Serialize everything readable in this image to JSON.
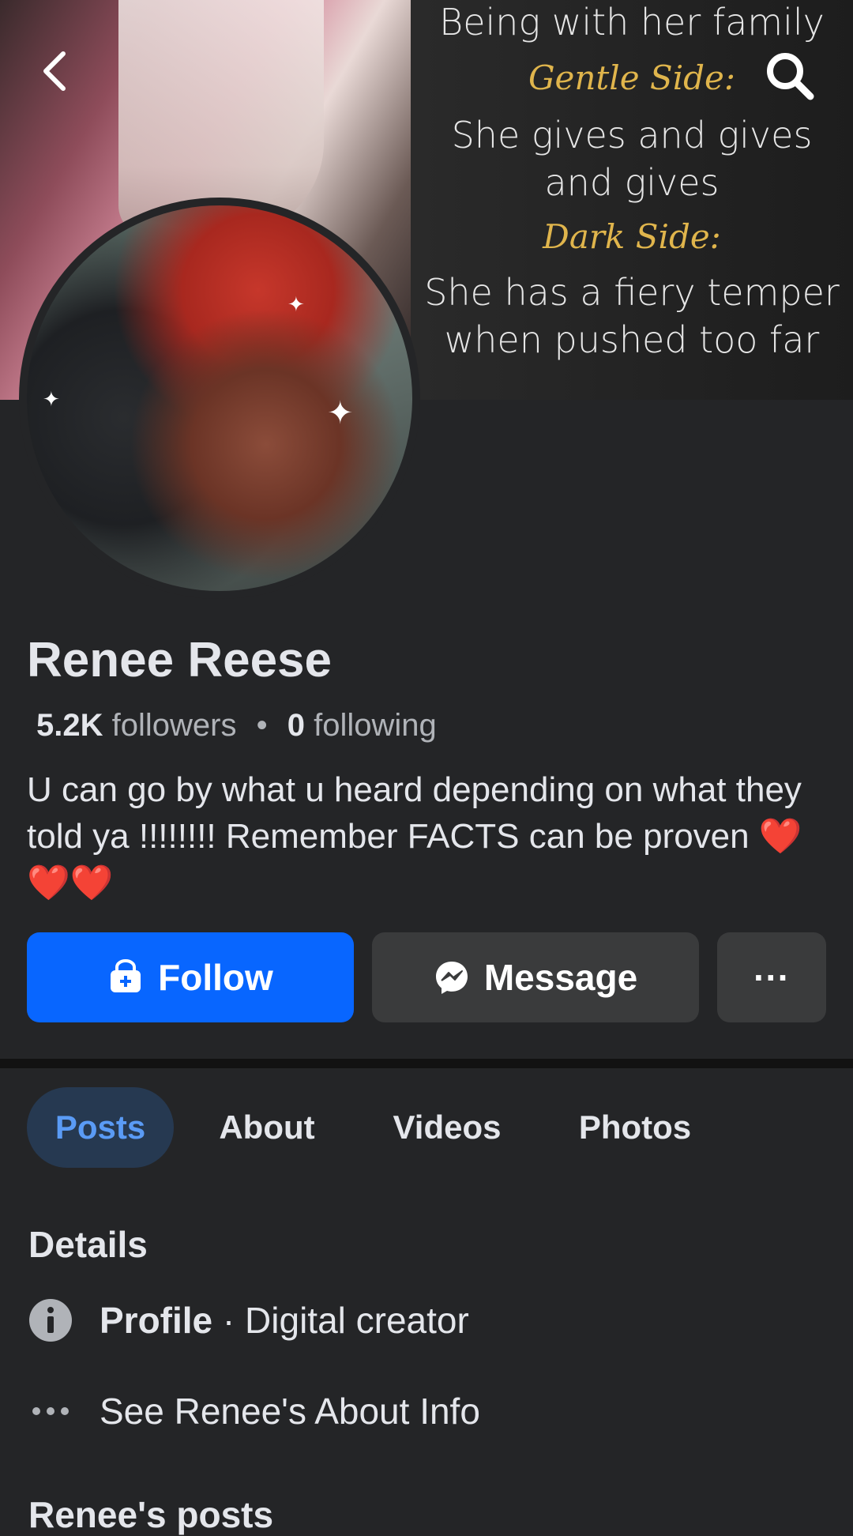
{
  "cover": {
    "lines": [
      {
        "text": "Being with her family",
        "style": "body"
      },
      {
        "text": "Gentle Side:",
        "style": "head"
      },
      {
        "text": "She gives and gives",
        "style": "body"
      },
      {
        "text": "and gives",
        "style": "body"
      },
      {
        "text": "Dark Side:",
        "style": "head"
      },
      {
        "text": "She has a fiery temper",
        "style": "body"
      },
      {
        "text": "when pushed too far",
        "style": "body"
      }
    ]
  },
  "profile": {
    "name": "Renee Reese",
    "followers_count": "5.2K",
    "followers_label": "followers",
    "separator": "•",
    "following_count": "0",
    "following_label": "following",
    "bio": "U can go by what u heard depending on what they told ya !!!!!!!! Remember FACTS can be proven ❤️❤️❤️"
  },
  "actions": {
    "follow_label": "Follow",
    "message_label": "Message",
    "more_label": "···"
  },
  "tabs": [
    "Posts",
    "About",
    "Videos",
    "Photos"
  ],
  "details": {
    "title": "Details",
    "profile_label": "Profile",
    "profile_sep": " · ",
    "profile_value": "Digital creator",
    "about_link": "See Renee's About Info"
  },
  "posts_title": "Renee's posts",
  "colors": {
    "background": "#242527",
    "follow_button": "#0866ff",
    "secondary_button": "#3a3b3c",
    "active_tab_bg": "#263951",
    "active_tab_text": "#5a9bf5",
    "cover_heading": "#e0b54c"
  }
}
